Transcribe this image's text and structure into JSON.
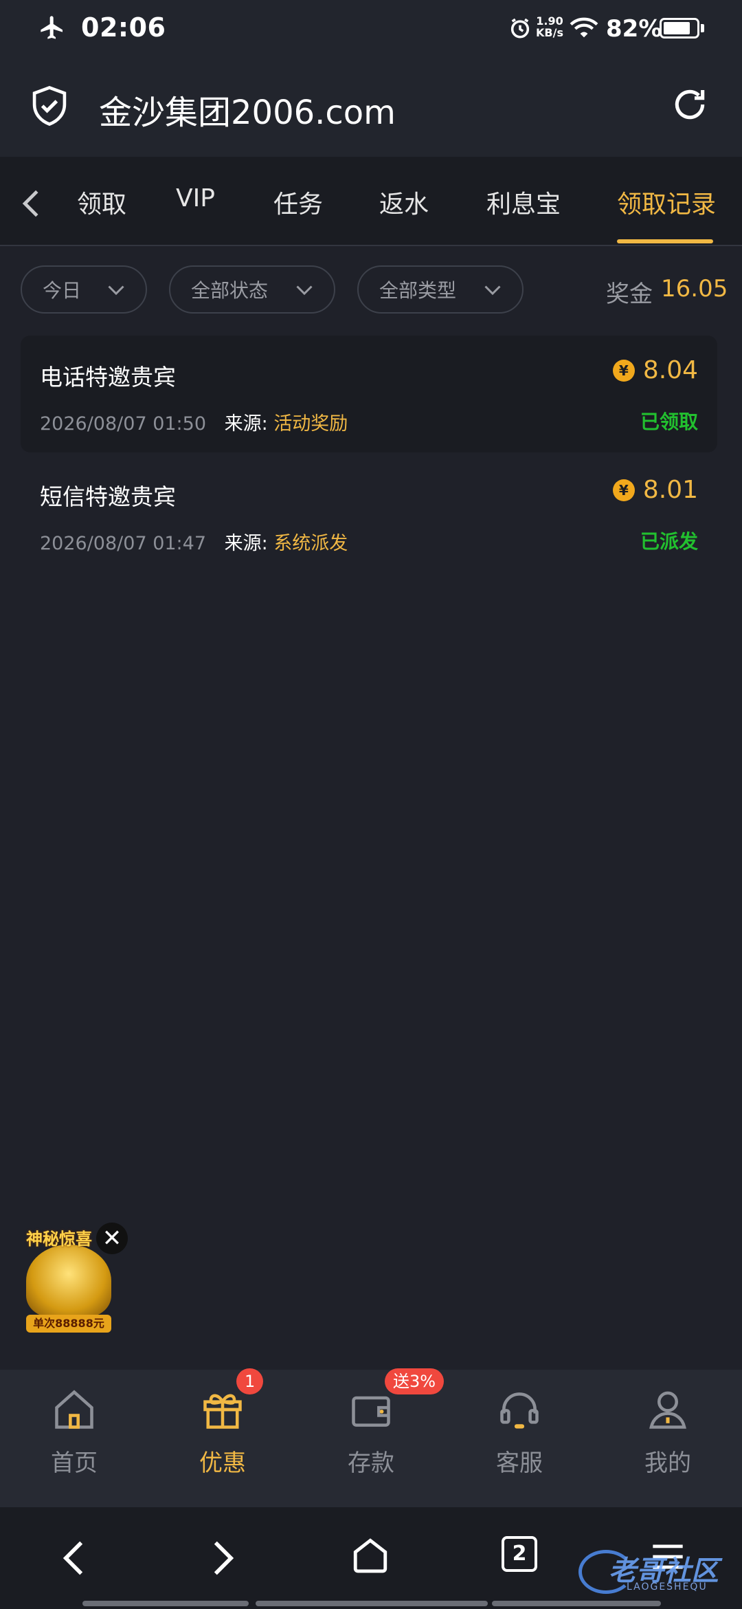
{
  "status_bar": {
    "time": "02:06",
    "speed_value": "1.90",
    "speed_unit": "KB/s",
    "battery": "82%",
    "battery_level": 0.82
  },
  "browser": {
    "url": "金沙集团2006.com"
  },
  "tabs": [
    {
      "label": "领取",
      "active": false
    },
    {
      "label": "VIP",
      "active": false
    },
    {
      "label": "任务",
      "active": false
    },
    {
      "label": "返水",
      "active": false
    },
    {
      "label": "利息宝",
      "active": false
    },
    {
      "label": "领取记录",
      "active": true
    }
  ],
  "filters": {
    "date": "今日",
    "status": "全部状态",
    "type": "全部类型"
  },
  "bonus": {
    "label": "奖金",
    "value": "16.05"
  },
  "records": [
    {
      "title": "电话特邀贵宾",
      "amount": "8.04",
      "time": "2026/08/07 01:50",
      "source_label": "来源:",
      "source": "活动奖励",
      "status": "已领取"
    },
    {
      "title": "短信特邀贵宾",
      "amount": "8.01",
      "time": "2026/08/07 01:47",
      "source_label": "来源:",
      "source": "系统派发",
      "status": "已派发"
    }
  ],
  "promo": {
    "title": "神秘惊喜",
    "label": "单次88888元",
    "close": "✕"
  },
  "coin_symbol": "¥",
  "bottom_nav": [
    {
      "label": "首页",
      "icon": "home-icon",
      "active": false
    },
    {
      "label": "优惠",
      "icon": "gift-icon",
      "active": true,
      "badge": "1"
    },
    {
      "label": "存款",
      "icon": "wallet-icon",
      "active": false,
      "badge": "送3%"
    },
    {
      "label": "客服",
      "icon": "headset-icon",
      "active": false
    },
    {
      "label": "我的",
      "icon": "user-icon",
      "active": false
    }
  ],
  "system_nav": {
    "tab_count": "2"
  },
  "watermark": {
    "main": "老哥社区",
    "sub": "LAOGESHEQU"
  },
  "colors": {
    "accent": "#f1b844",
    "success": "#22c02f",
    "background": "#1f2129",
    "badge": "#f0483e"
  }
}
